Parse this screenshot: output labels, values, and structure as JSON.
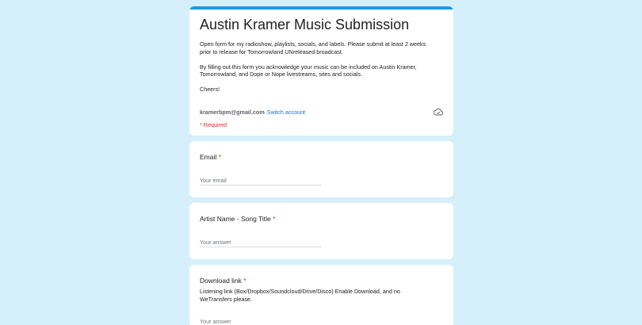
{
  "form": {
    "title": "Austin Kramer Music Submission",
    "description": [
      "Open form for my radioshow, playlists, socials, and labels.  Please submit at least 2 weeks prior to release for Tomorrowland UNreleased broadcast.",
      "By filling out this form you acknowledge your music can be included on Austin Kramer, Tomorrowland, and Dope or Nope livestreams, sites and socials.",
      "Cheers!"
    ],
    "account_email": "kramerbpm@gmail.com",
    "switch_account_label": "Switch account",
    "required_note": "* Required",
    "accent_color": "#1a9be8"
  },
  "questions": [
    {
      "label": "Email",
      "required_mark": "*",
      "placeholder": "Your email",
      "help": ""
    },
    {
      "label": "Artist Name - Song Title",
      "required_mark": "*",
      "placeholder": "Your answer",
      "help": ""
    },
    {
      "label": "Download link",
      "required_mark": "*",
      "placeholder": "Your answer",
      "help": "Listening link (Box/Dropbox/Soundcloud/Drive/Disco)   Enable Download, and no WeTransfers please."
    }
  ]
}
